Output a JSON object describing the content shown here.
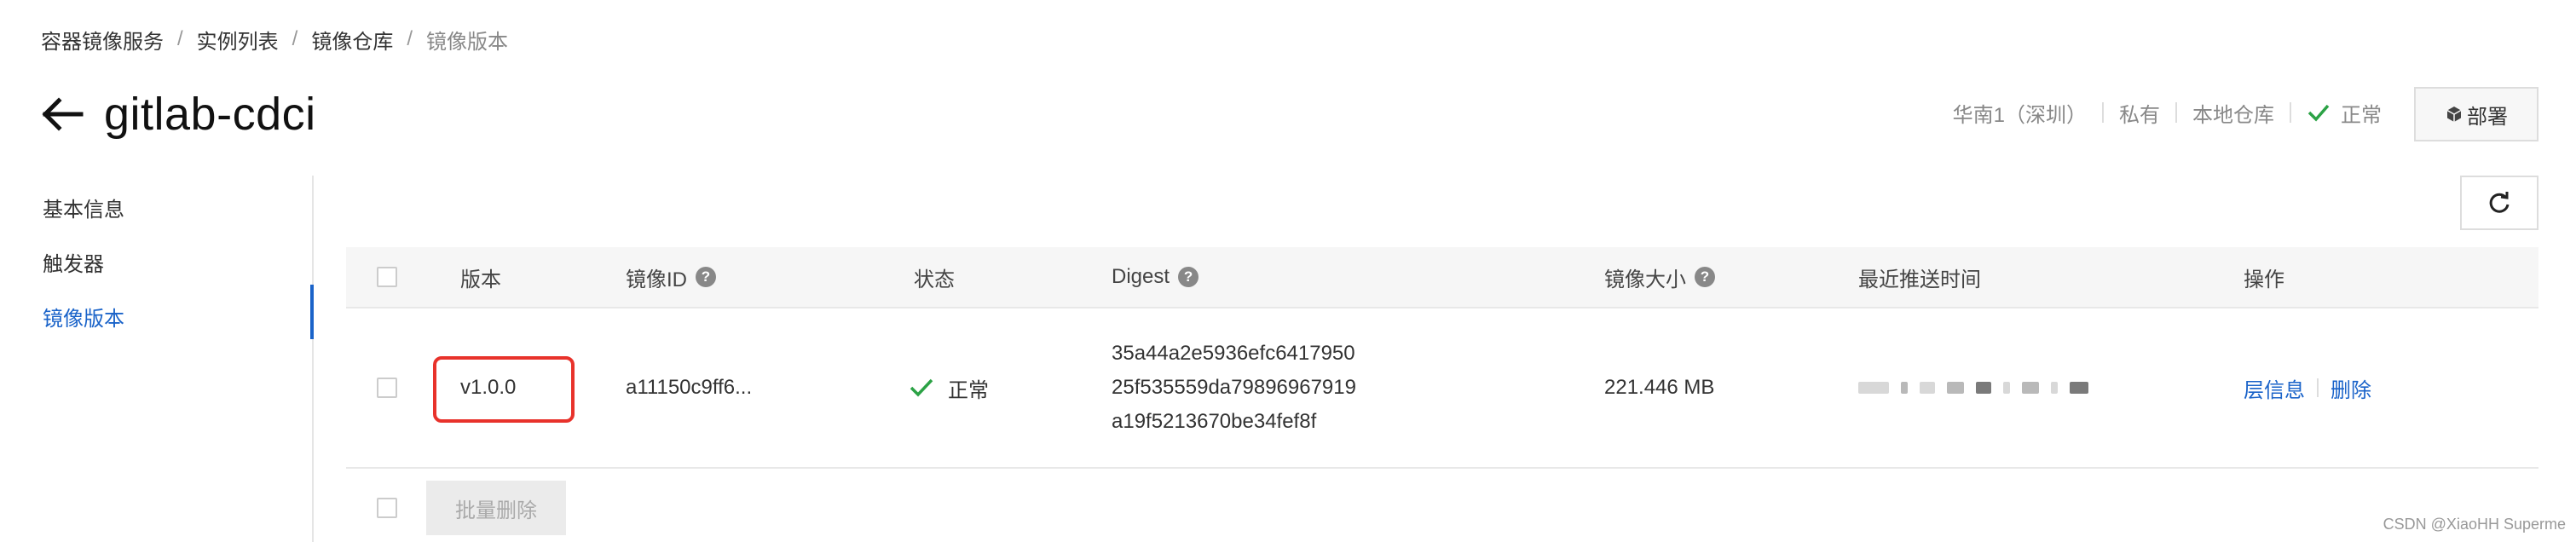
{
  "breadcrumb": [
    "容器镜像服务",
    "实例列表",
    "镜像仓库",
    "镜像版本"
  ],
  "header": {
    "title": "gitlab-cdci",
    "meta": {
      "region": "华南1（深圳）",
      "visibility": "私有",
      "repo_type": "本地仓库",
      "status": "正常"
    },
    "deploy_label": "部署"
  },
  "sidebar": {
    "items": [
      {
        "label": "基本信息",
        "active": false
      },
      {
        "label": "触发器",
        "active": false
      },
      {
        "label": "镜像版本",
        "active": true
      }
    ]
  },
  "table": {
    "columns": {
      "version": "版本",
      "image_id": "镜像ID",
      "status": "状态",
      "digest": "Digest",
      "size": "镜像大小",
      "push_time": "最近推送时间",
      "actions": "操作"
    },
    "rows": [
      {
        "version": "v1.0.0",
        "image_id": "a11150c9ff6...",
        "status": "正常",
        "digest_lines": [
          "35a44a2e5936efc6417950",
          "25f535559da79896967919",
          "a19f5213670be34fef8f"
        ],
        "size": "221.446 MB",
        "push_time": "",
        "actions": {
          "layer_info": "层信息",
          "delete": "删除"
        }
      }
    ]
  },
  "footer": {
    "batch_delete": "批量删除"
  },
  "watermark": "CSDN @XiaoHH Superme",
  "colors": {
    "link": "#1a63c9",
    "success": "#2ba245",
    "highlight": "#e8322b"
  }
}
